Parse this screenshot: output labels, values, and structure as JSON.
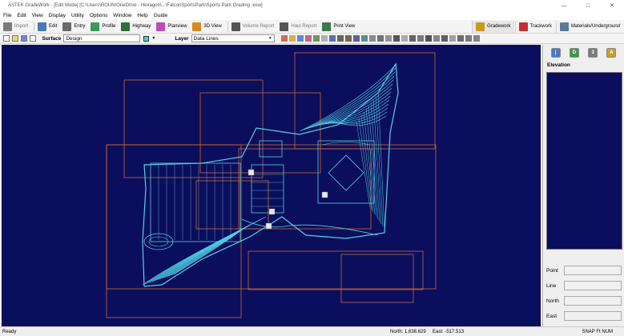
{
  "window": {
    "title": "ASTEK GradeWork - [Edit Mode] [C:\\Users\\ROUN\\OneDrive - Hexagon\\...\\FalconSportsPark\\Sports Park Grading .esw]",
    "minimize": "—",
    "maximize": "□",
    "close": "✕"
  },
  "menu": [
    "File",
    "Edit",
    "View",
    "Display",
    "Utility",
    "Options",
    "Window",
    "Help",
    "Guide"
  ],
  "toolbar": {
    "left": [
      {
        "label": "Import",
        "icon": "import-icon",
        "color": "#7a7a7a",
        "disabled": true
      },
      {
        "label": "Edit",
        "icon": "edit-icon",
        "color": "#4a78b8",
        "disabled": false
      },
      {
        "label": "Entry",
        "icon": "entry-icon",
        "color": "#6a6a6a",
        "disabled": false
      },
      {
        "label": "Profile",
        "icon": "profile-icon",
        "color": "#3d9a56",
        "disabled": false
      },
      {
        "label": "Highway",
        "icon": "highway-icon",
        "color": "#2f6f3a",
        "disabled": false
      },
      {
        "label": "Planview",
        "icon": "planview-icon",
        "color": "#c04ab8",
        "disabled": false
      },
      {
        "label": "3D View",
        "icon": "3d-view-icon",
        "color": "#d88a20",
        "disabled": false
      },
      {
        "label": "Volume Report",
        "icon": "volume-report-icon",
        "color": "#555555",
        "disabled": true
      },
      {
        "label": "Haul Report",
        "icon": "haul-report-icon",
        "color": "#555555",
        "disabled": true
      },
      {
        "label": "Print View",
        "icon": "print-view-icon",
        "color": "#3a7a4a",
        "disabled": false
      }
    ],
    "right": [
      {
        "label": "Gradework",
        "icon": "gradework-icon",
        "color": "#c89a20",
        "active": true
      },
      {
        "label": "Trackwork",
        "icon": "trackwork-icon",
        "color": "#c03030",
        "active": false
      },
      {
        "label": "Materials/Underground",
        "icon": "materials-icon",
        "color": "#5a7a9a",
        "active": false
      }
    ]
  },
  "layer_bar": {
    "surface_label": "Surface",
    "surface_value": "Design",
    "layer_label": "Layer",
    "layer_value": "Data Lines",
    "swatch_color": "#46d4d4"
  },
  "canvas": {
    "background": "#0b0e5c",
    "contour_color": "#4fd2e6",
    "boundary_color": "#c86a3a"
  },
  "side_panel": {
    "elevation_label": "Elevation",
    "icons": [
      {
        "name": "panel-blue-icon",
        "glyph": "|",
        "color": "#4a7ac8"
      },
      {
        "name": "panel-green-icon",
        "glyph": "D",
        "color": "#3a9a4a"
      },
      {
        "name": "panel-gray-icon",
        "glyph": "3",
        "color": "#7a7a7a"
      },
      {
        "name": "panel-gold-icon",
        "glyph": "A",
        "color": "#c8a030"
      }
    ],
    "point_label": "Point",
    "line_label": "Line",
    "north_label": "North",
    "east_label": "East"
  },
  "status": {
    "ready": "Ready",
    "north": "North: 1,638.629",
    "east": "East: -517.513",
    "flags": "SNAP  Ft  NUM"
  }
}
